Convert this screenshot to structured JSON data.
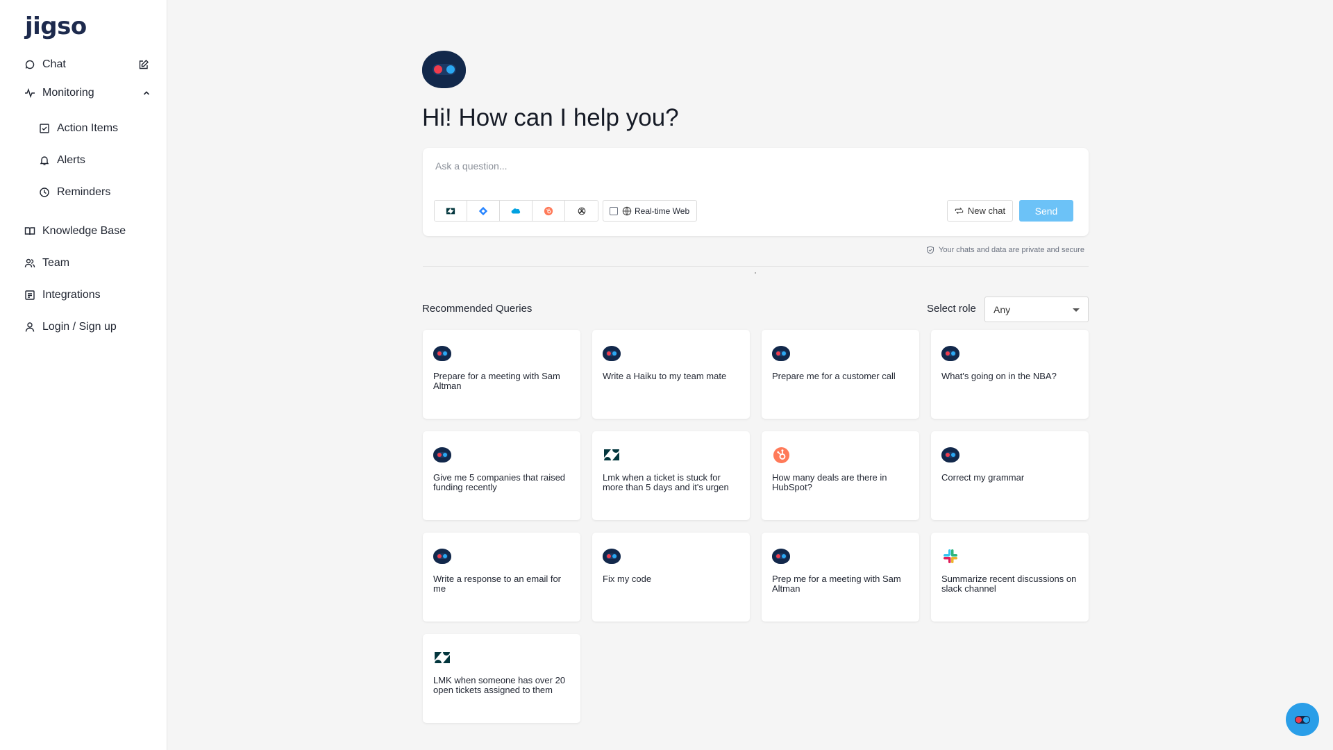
{
  "app": {
    "logo": "jigso"
  },
  "sidebar": {
    "items": [
      {
        "label": "Chat",
        "icon": "chat-bubble-icon"
      },
      {
        "label": "Monitoring",
        "icon": "activity-icon"
      },
      {
        "label": "Action Items",
        "icon": "checkbox-icon"
      },
      {
        "label": "Alerts",
        "icon": "bell-icon"
      },
      {
        "label": "Reminders",
        "icon": "clock-icon"
      },
      {
        "label": "Knowledge Base",
        "icon": "book-icon"
      },
      {
        "label": "Team",
        "icon": "team-icon"
      },
      {
        "label": "Integrations",
        "icon": "integrations-icon"
      },
      {
        "label": "Login / Sign up",
        "icon": "user-icon"
      }
    ]
  },
  "main": {
    "greeting": "Hi! How can I help you?",
    "input_placeholder": "Ask a question...",
    "tools": [
      "zendesk-icon",
      "jira-icon",
      "salesforce-icon",
      "hubspot-icon",
      "openai-icon"
    ],
    "realtime_web_label": "Real-time Web",
    "new_chat_label": "New chat",
    "send_label": "Send",
    "privacy_note": "Your chats and data are private and secure",
    "recommended_title": "Recommended Queries",
    "role_label": "Select role",
    "role_value": "Any"
  },
  "colors": {
    "accent": "#6cc2f7",
    "brand_dark": "#12284b",
    "bot_red": "#ef3c4d",
    "bot_blue": "#2ba8f3",
    "fab": "#2a9ee8"
  },
  "queries": [
    {
      "text": "Prepare for a meeting with Sam Altman",
      "icon": "jigso-bot-icon"
    },
    {
      "text": "Write a Haiku to my team mate",
      "icon": "jigso-bot-icon"
    },
    {
      "text": "Prepare me for a customer call",
      "icon": "jigso-bot-icon"
    },
    {
      "text": "What's going on in the NBA?",
      "icon": "jigso-bot-icon"
    },
    {
      "text": "Give me 5 companies that raised funding recently",
      "icon": "jigso-bot-icon"
    },
    {
      "text": "Lmk when a ticket is stuck for more than 5 days and it's urgen",
      "icon": "zendesk-icon"
    },
    {
      "text": "How many deals are there in HubSpot?",
      "icon": "hubspot-icon"
    },
    {
      "text": "Correct my grammar",
      "icon": "jigso-bot-icon"
    },
    {
      "text": "Write a response to an email for me",
      "icon": "jigso-bot-icon"
    },
    {
      "text": "Fix my code",
      "icon": "jigso-bot-icon"
    },
    {
      "text": "Prep me for a meeting with Sam Altman",
      "icon": "jigso-bot-icon"
    },
    {
      "text": "Summarize recent discussions on slack channel",
      "icon": "slack-icon"
    },
    {
      "text": "LMK when someone has over 20 open tickets assigned to them",
      "icon": "zendesk-icon"
    }
  ]
}
